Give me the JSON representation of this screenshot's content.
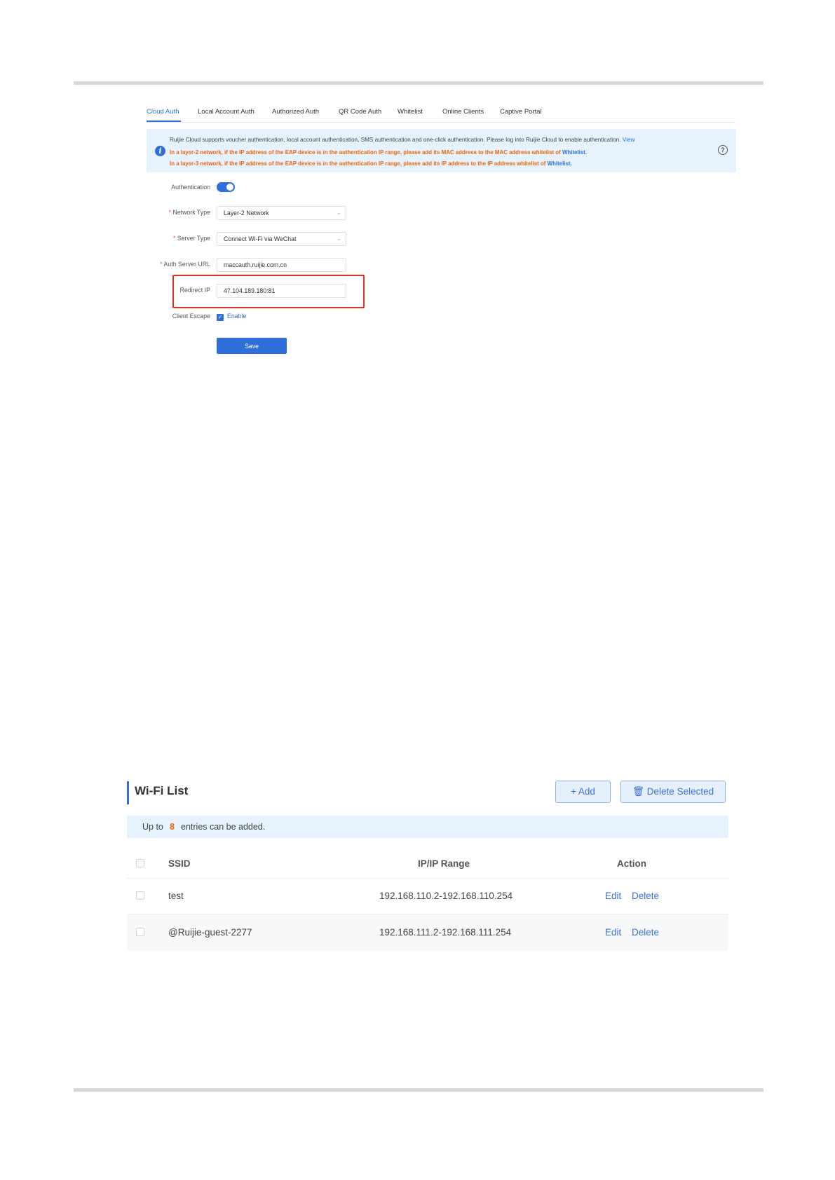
{
  "tabs": [
    {
      "label": "Cloud Auth",
      "active": true
    },
    {
      "label": "Local Account Auth"
    },
    {
      "label": "Authorized Auth"
    },
    {
      "label": "QR Code Auth"
    },
    {
      "label": "Whitelist"
    },
    {
      "label": "Online Clients"
    },
    {
      "label": "Captive Portal"
    }
  ],
  "notice": {
    "line1": "Ruijie Cloud supports voucher authentication, local account authentication, SMS authentication and one-click authentication. Please log into Ruijie Cloud to enable authentication.",
    "line1_link": "View",
    "line2": "In a layer-2 network, if the IP address of the EAP device is in the authentication IP range, please add its MAC address to the MAC address whitelist of",
    "line2_link": "Whitelist.",
    "line3": "In a layer-3 network, if the IP address of the EAP device is in the authentication IP range, please add its IP address to the IP address whitelist of",
    "line3_link": "Whitelist."
  },
  "form": {
    "authentication_label": "Authentication",
    "authentication_enabled": true,
    "network_type_label": "Network Type",
    "network_type_value": "Layer-2 Network",
    "server_type_label": "Server Type",
    "server_type_value": "Connect Wi-Fi via WeChat",
    "auth_server_url_label": "Auth Server URL",
    "auth_server_url_value": "maccauth.ruijie.com.cn",
    "redirect_ip_label": "Redirect IP",
    "redirect_ip_value": "47.104.189.180:81",
    "client_escape_label": "Client Escape",
    "client_escape_option": "Enable",
    "save_label": "Save",
    "required_mark": "*"
  },
  "wifi_list": {
    "title": "Wi-Fi List",
    "add_label": "+ Add",
    "delete_selected_label": "Delete Selected",
    "limit_prefix": "Up to",
    "limit_count": "8",
    "limit_suffix": "entries can be added.",
    "columns": [
      "SSID",
      "IP/IP Range",
      "Action"
    ],
    "rows": [
      {
        "ssid": "test",
        "ip_range": "192.168.110.2-192.168.110.254",
        "edit": "Edit",
        "delete": "Delete"
      },
      {
        "ssid": "@Ruijie-guest-2277",
        "ip_range": "192.168.111.2-192.168.111.254",
        "edit": "Edit",
        "delete": "Delete"
      }
    ]
  },
  "colors": {
    "accent": "#2f6fdb",
    "warning": "#e8650a",
    "highlight_box": "#e0302c"
  }
}
